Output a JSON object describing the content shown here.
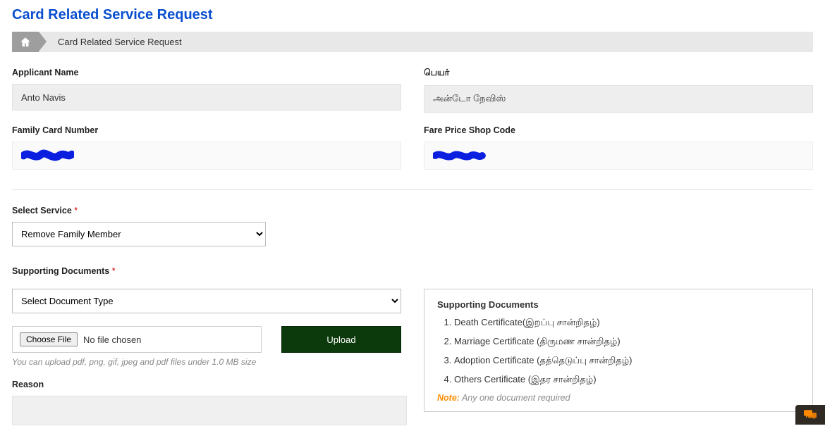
{
  "page": {
    "title": "Card Related Service Request"
  },
  "breadcrumb": {
    "current": "Card Related Service Request"
  },
  "fields": {
    "applicant_name_label": "Applicant Name",
    "applicant_name_value": "Anto Navis",
    "name_ta_label": "பெயர்",
    "name_ta_value": "அன்டோ நேவிஸ்",
    "family_card_label": "Family Card Number",
    "fare_shop_label": "Fare Price Shop Code",
    "select_service_label": "Select Service",
    "select_service_value": "Remove Family Member",
    "supporting_docs_label": "Supporting Documents",
    "doc_type_placeholder": "Select Document Type",
    "choose_file_label": "Choose File",
    "no_file_text": "No file chosen",
    "upload_label": "Upload",
    "upload_hint": "You can upload pdf, png, gif, jpeg and pdf files under 1.0 MB size",
    "reason_label": "Reason"
  },
  "doc_panel": {
    "title": "Supporting Documents",
    "items": [
      "Death Certificate(இறப்பு சான்றிதழ்)",
      "Marriage Certificate (திருமண சான்றிதழ்)",
      "Adoption Certificate (தத்தெடுப்பு சான்றிதழ்)",
      "Others Certificate (இதர சான்றிதழ்)"
    ],
    "note_label": "Note:",
    "note_text": " Any one document required"
  }
}
